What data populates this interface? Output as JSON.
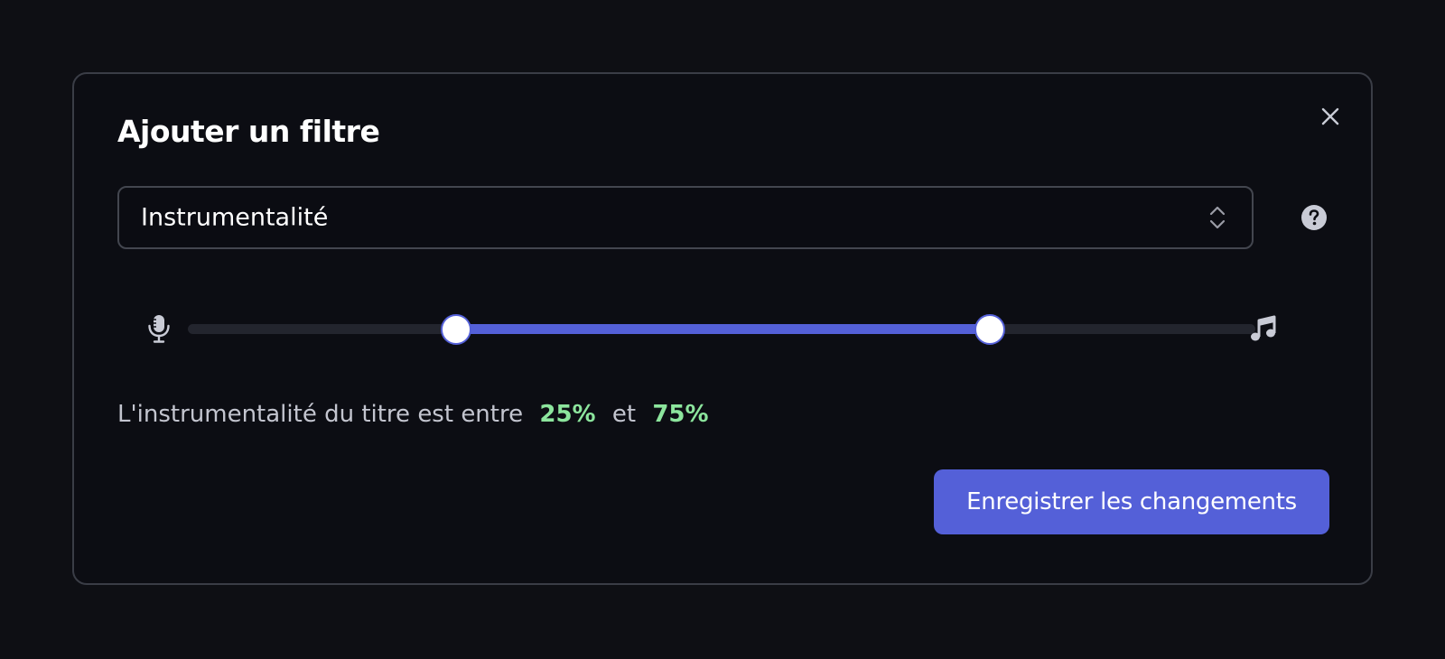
{
  "modal": {
    "title": "Ajouter un filtre",
    "close_icon": "close-icon"
  },
  "filter_select": {
    "value": "Instrumentalité",
    "icon": "chevron-up-down-icon"
  },
  "help": {
    "icon": "question-circle-icon"
  },
  "slider": {
    "left_icon": "microphone-icon",
    "right_icon": "music-note-icon",
    "min_value": 0.25,
    "max_value": 0.75
  },
  "summary": {
    "prefix": "L'instrumentalité du titre est entre",
    "min_label": "25%",
    "conjunction": "et",
    "max_label": "75%"
  },
  "actions": {
    "save_label": "Enregistrer les changements"
  },
  "colors": {
    "accent": "#5460d8",
    "highlight": "#8ce59d",
    "background": "#0c0d13"
  }
}
